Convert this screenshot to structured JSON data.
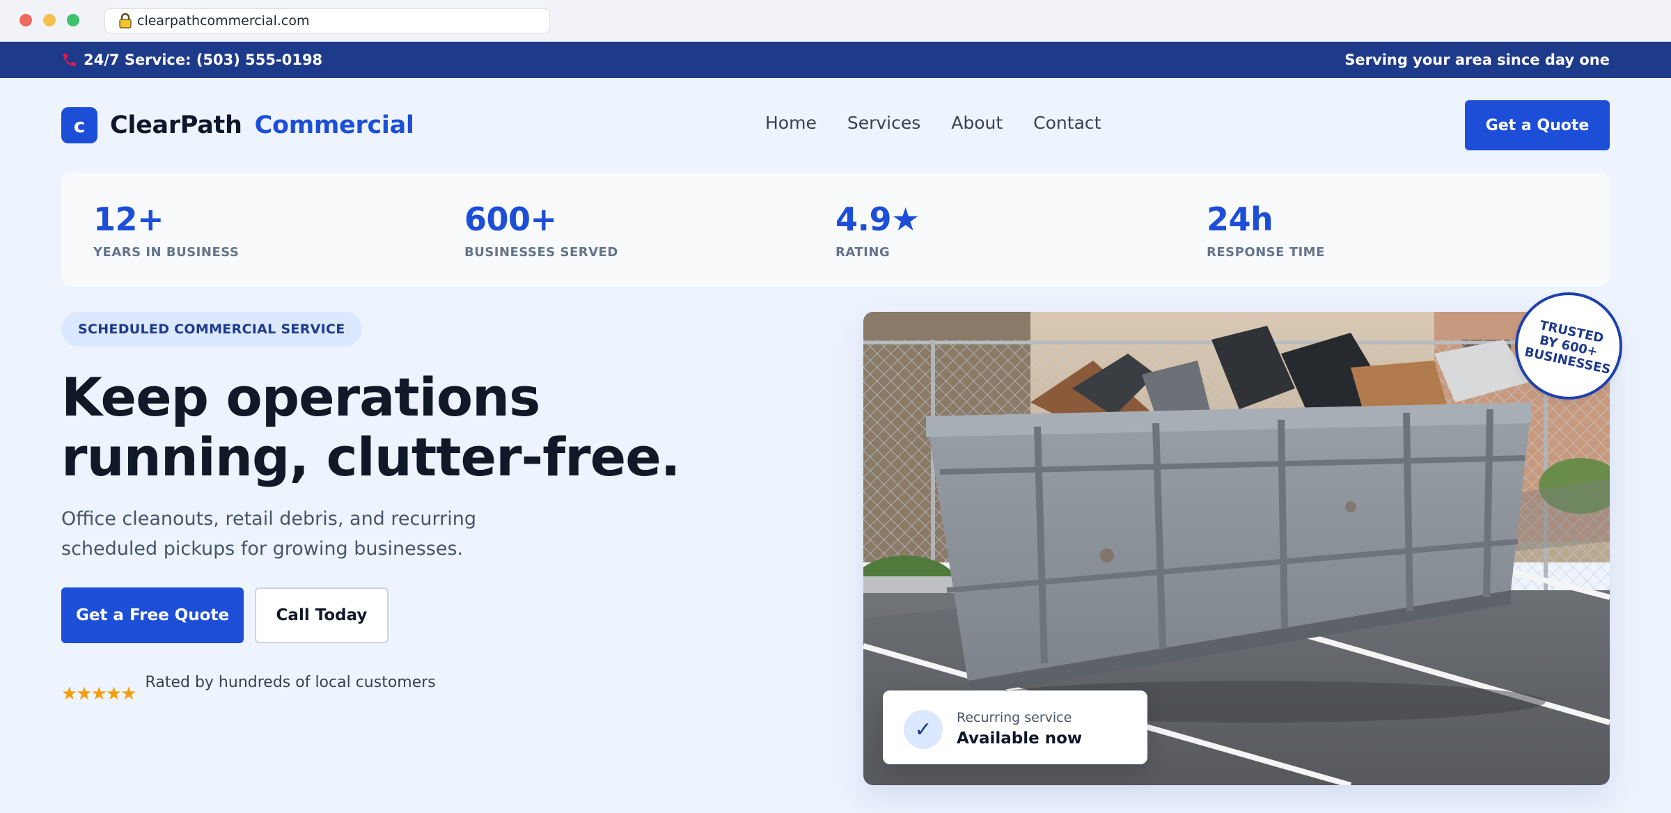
{
  "browser": {
    "url": "clearpathcommercial.com"
  },
  "topbar": {
    "phone_text": "24/7 Service: (503) 555-0198",
    "tagline": "Serving your area since day one"
  },
  "header": {
    "logo_letter": "c",
    "brand_name": "ClearPath",
    "brand_accent": "Commercial",
    "nav": [
      "Home",
      "Services",
      "About",
      "Contact"
    ],
    "cta": "Get a Quote"
  },
  "stats": [
    {
      "value": "12+",
      "label": "YEARS IN BUSINESS"
    },
    {
      "value": "600+",
      "label": "BUSINESSES SERVED"
    },
    {
      "value": "4.9★",
      "label": "RATING"
    },
    {
      "value": "24h",
      "label": "RESPONSE TIME"
    }
  ],
  "hero": {
    "pill": "SCHEDULED COMMERCIAL SERVICE",
    "title_line1": "Keep operations",
    "title_line2": "running, clutter-free.",
    "subtitle": "Office cleanouts, retail debris, and recurring scheduled pickups for growing businesses.",
    "primary_cta": "Get a Free Quote",
    "secondary_cta": "Call Today",
    "stars": "★★★★★",
    "rating_text": "Rated by hundreds of local customers"
  },
  "badge": {
    "text": "TRUSTED BY 600+ BUSINESSES"
  },
  "status_card": {
    "label": "Recurring service",
    "value": "Available now",
    "icon": "check-icon"
  },
  "colors": {
    "primary": "#1d4ed8",
    "topbar": "#1e3a8a",
    "background": "#eef4fe",
    "star": "#f59e0b"
  }
}
